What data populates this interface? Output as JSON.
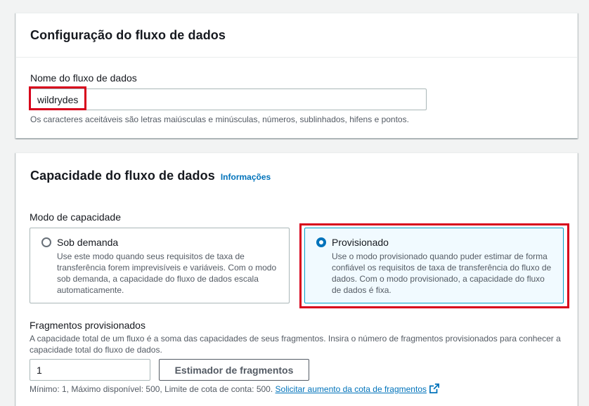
{
  "stream_config": {
    "title": "Configuração do fluxo de dados",
    "name_label": "Nome do fluxo de dados",
    "name_value": "wildrydes",
    "name_hint": "Os caracteres aceitáveis são letras maiúsculas e minúsculas, números, sublinhados, hifens e pontos."
  },
  "capacity": {
    "title": "Capacidade do fluxo de dados",
    "info_link": "Informações",
    "mode_label": "Modo de capacidade",
    "modes": [
      {
        "title": "Sob demanda",
        "description": "Use este modo quando seus requisitos de taxa de transferência forem imprevisíveis e variáveis. Com o modo sob demanda, a capacidade do fluxo de dados escala automaticamente.",
        "selected": false
      },
      {
        "title": "Provisionado",
        "description": "Use o modo provisionado quando puder estimar de forma confiável os requisitos de taxa de transferência do fluxo de dados. Com o modo provisionado, a capacidade do fluxo de dados é fixa.",
        "selected": true
      }
    ],
    "shards_label": "Fragmentos provisionados",
    "shards_hint": "A capacidade total de um fluxo é a soma das capacidades de seus fragmentos. Insira o número de fragmentos provisionados para conhecer a capacidade total do fluxo de dados.",
    "shards_value": "1",
    "estimator_button": "Estimador de fragmentos",
    "limits_text": "Mínimo: 1, Máximo disponível: 500, Limite de cota de conta: 500.",
    "quota_link": "Solicitar aumento da cota de fragmentos"
  },
  "colors": {
    "link": "#0073bb",
    "highlight": "#d7001b",
    "selected_border": "#00a1c9",
    "selected_bg": "#f1faff"
  },
  "icons": {
    "external_link": "external-link-icon"
  }
}
